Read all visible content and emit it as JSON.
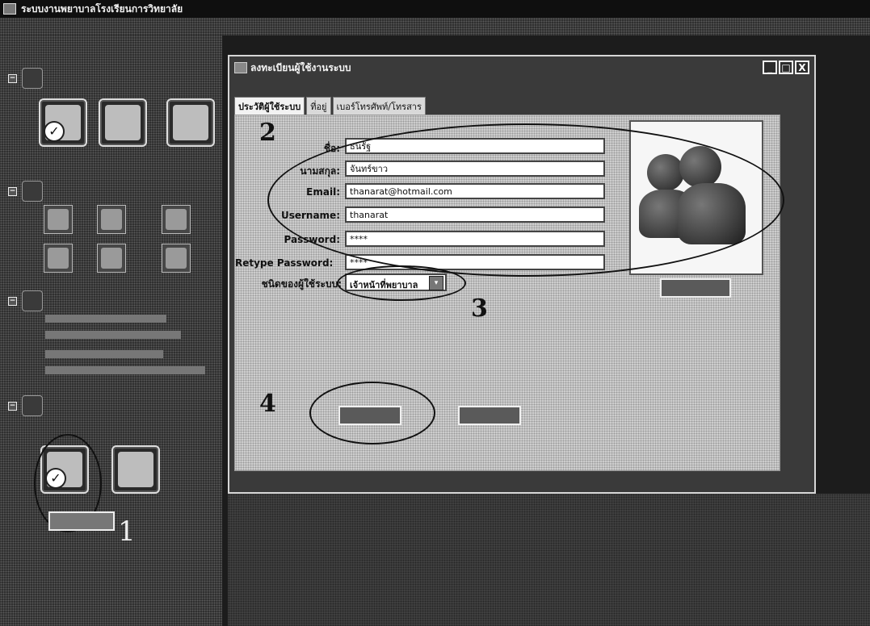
{
  "app": {
    "title": "ระบบงานพยาบาลโรงเรียนการวิทยาลัย"
  },
  "child_window": {
    "title": "ลงทะเบียนผู้ใช้งานระบบ",
    "buttons": {
      "minimize": "_",
      "maximize": "□",
      "close": "X"
    }
  },
  "tabs": [
    {
      "label": "ประวัติผู้ใช้ระบบ"
    },
    {
      "label": "ที่อยู่"
    },
    {
      "label": "เบอร์โทรศัพท์/โทรสาร"
    }
  ],
  "form": {
    "name_label": "ชื่อ:",
    "name_value": "ธนรัฐ",
    "surname_label": "นามสกุล:",
    "surname_value": "จันทร์ขาว",
    "email_label": "Email:",
    "email_value": "thanarat@hotmail.com",
    "username_label": "Username:",
    "username_value": "thanarat",
    "password_label": "Password:",
    "password_value": "****",
    "retype_label": "Retype Password:",
    "retype_value": "****",
    "user_type_label": "ชนิดของผู้ใช้ระบบ:",
    "user_type_value": "เจ้าหน้าที่พยาบาล"
  },
  "callouts": {
    "c1": "1",
    "c2": "2",
    "c3": "3",
    "c4": "4"
  },
  "sidebar": {
    "combo_arrow": "▾"
  },
  "icons": {
    "app": "window-icon",
    "photo": "users-photo-icon"
  }
}
